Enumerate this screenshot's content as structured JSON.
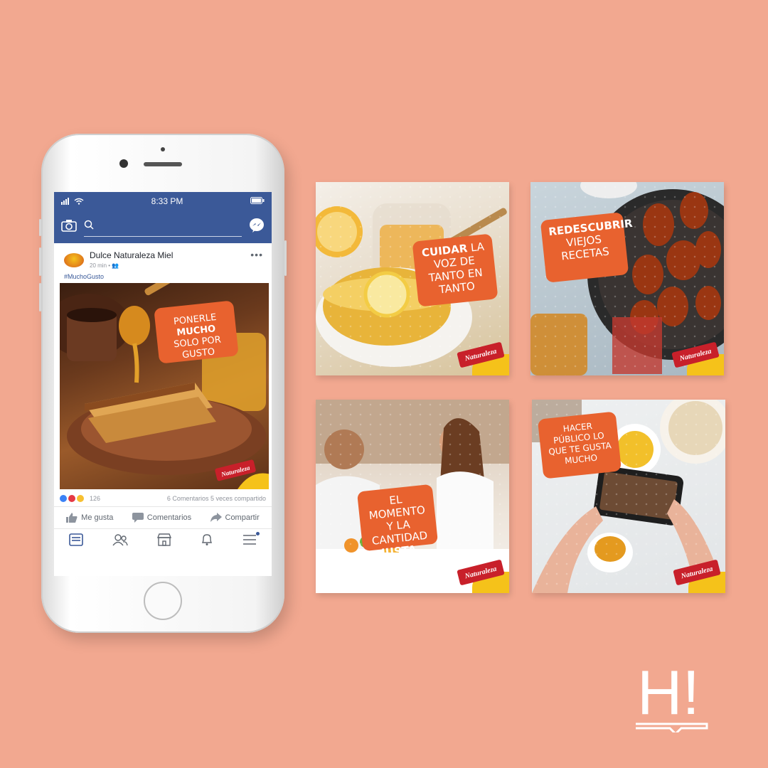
{
  "phone": {
    "status": {
      "time": "8:33 PM"
    },
    "post": {
      "page_name": "Dulce Naturaleza Miel",
      "time": "20 min",
      "hashtag": "#MuchoGusto",
      "bubble_pre": "Ponerle",
      "bubble_bold": "mucho",
      "bubble_post": "solo por gusto",
      "reaction_count": "126",
      "stats": "6 Comentarios  5 veces compartido"
    },
    "actions": {
      "like": "Me gusta",
      "comment": "Comentarios",
      "share": "Compartir"
    }
  },
  "cards": [
    {
      "bubble_bold": "Cuidar",
      "bubble_rest": "la voz de tanto en tanto"
    },
    {
      "bubble_bold": "Redescubrir",
      "bubble_rest": "viejos recetas"
    },
    {
      "bubble_rest": "El momento y la cantidad",
      "bubble_bold": "justa."
    },
    {
      "bubble_rest": "Hacer público lo que te gusta mucho"
    }
  ],
  "brand_ribbon": "Naturaleza",
  "corner_logo": "H!",
  "colors": {
    "background": "#f2a890",
    "facebook_blue": "#3b5998",
    "bubble_orange": "#e8622f"
  },
  "icons": [
    "signal-icon",
    "wifi-icon",
    "battery-icon",
    "camera-icon",
    "search-icon",
    "messenger-icon",
    "like-icon",
    "comment-icon",
    "share-icon",
    "news-feed-icon",
    "friends-icon",
    "marketplace-icon",
    "bell-icon",
    "menu-icon"
  ]
}
